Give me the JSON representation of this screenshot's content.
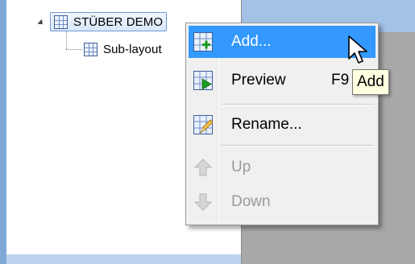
{
  "tree": {
    "root": {
      "label": "STÜBER DEMO",
      "icon": "grid-layout-icon",
      "expanded": true
    },
    "children": [
      {
        "label": "Sub-layout",
        "icon": "grid-layout-icon"
      }
    ]
  },
  "context_menu": {
    "items": [
      {
        "label": "Add...",
        "icon": "grid-add-icon",
        "highlighted": true,
        "enabled": true
      },
      {
        "label": "Preview",
        "shortcut": "F9",
        "icon": "grid-preview-icon",
        "enabled": true
      },
      {
        "label": "Rename...",
        "icon": "grid-rename-icon",
        "enabled": true
      },
      {
        "label": "Up",
        "icon": "arrow-up-icon",
        "enabled": false
      },
      {
        "label": "Down",
        "icon": "arrow-down-icon",
        "enabled": false
      }
    ]
  },
  "tooltip": {
    "text": "Add"
  },
  "colors": {
    "highlight": "#3399ff",
    "tooltip_bg": "#ffffe1",
    "menu_bg": "#f0f0f0",
    "disabled_text": "#9a9a9a"
  }
}
